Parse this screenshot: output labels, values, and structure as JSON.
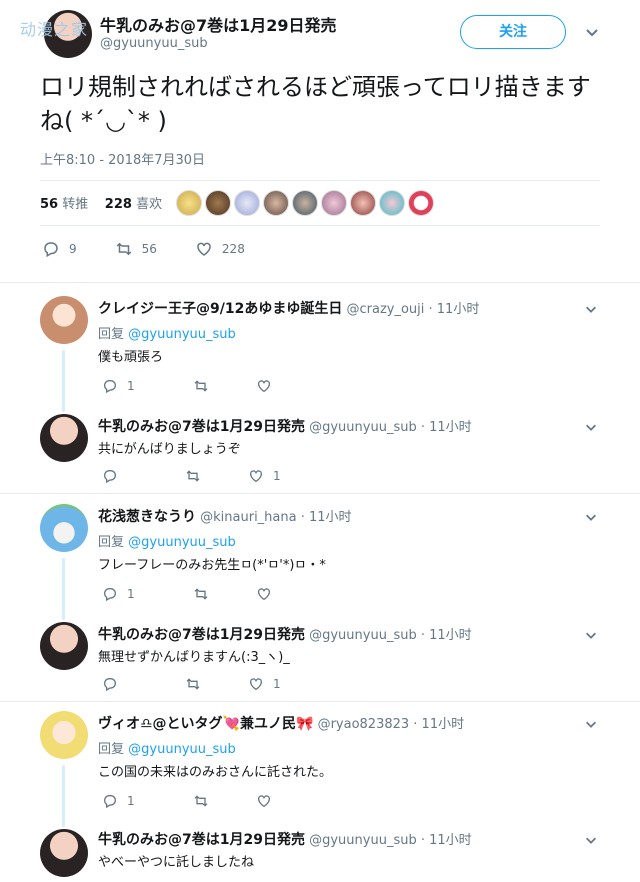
{
  "watermark": "动漫之家",
  "header": {
    "name": "牛乳のみお@7巻は1月29日発売",
    "handle": "@gyuunyuu_sub",
    "follow_label": "关注"
  },
  "tweet": {
    "text": "ロリ規制されればされるほど頑張ってロリ描きますね( *´◡`* )",
    "time": "上午8:10 - 2018年7月30日",
    "retweets_count": "56",
    "retweets_label": "转推",
    "likes_count": "228",
    "likes_label": "喜欢",
    "actions": {
      "reply": "9",
      "retweet": "56",
      "like": "228"
    }
  },
  "replies": [
    {
      "name": "クレイジー王子@9/12あゆまゆ誕生日",
      "sub": "@crazy_ouji · 11小时",
      "reply_prefix": "回复",
      "reply_to": "@gyuunyuu_sub",
      "text": "僕も頑張ろ",
      "reply_count": "1",
      "like_count": ""
    },
    {
      "name": "牛乳のみお@7巻は1月29日発売",
      "sub": "@gyuunyuu_sub · 11小时",
      "text": "共にがんばりましょうぞ",
      "reply_count": "",
      "like_count": "1"
    },
    {
      "name": "花浅葱きなうり",
      "sub": "@kinauri_hana · 11小时",
      "reply_prefix": "回复",
      "reply_to": "@gyuunyuu_sub",
      "text": "フレーフレーのみお先生ㅁ(*'ㅁ'*)ㅁ・*",
      "reply_count": "1",
      "like_count": ""
    },
    {
      "name": "牛乳のみお@7巻は1月29日発売",
      "sub": "@gyuunyuu_sub · 11小时",
      "text": "無理せずかんばりますん(:3_ヽ)_",
      "reply_count": "",
      "like_count": "1"
    },
    {
      "name": "ヴィオ♎@といタグ💘兼ユノ民🎀",
      "sub": "@ryao823823 · 11小时",
      "reply_prefix": "回复",
      "reply_to": "@gyuunyuu_sub",
      "text": "この国の未来はのみおさんに託された。",
      "reply_count": "1",
      "like_count": ""
    },
    {
      "name": "牛乳のみお@7巻は1月29日発売",
      "sub": "@gyuunyuu_sub · 11小时",
      "text": "やべーやつに託しましたね",
      "reply_count": "",
      "like_count": ""
    }
  ],
  "icons": {
    "reply": "reply-icon",
    "retweet": "retweet-icon",
    "like": "heart-icon",
    "more": "chevron-down-icon"
  },
  "colors": {
    "accent": "#1da1f2",
    "muted": "#657786",
    "thread": "#d6eefb"
  }
}
